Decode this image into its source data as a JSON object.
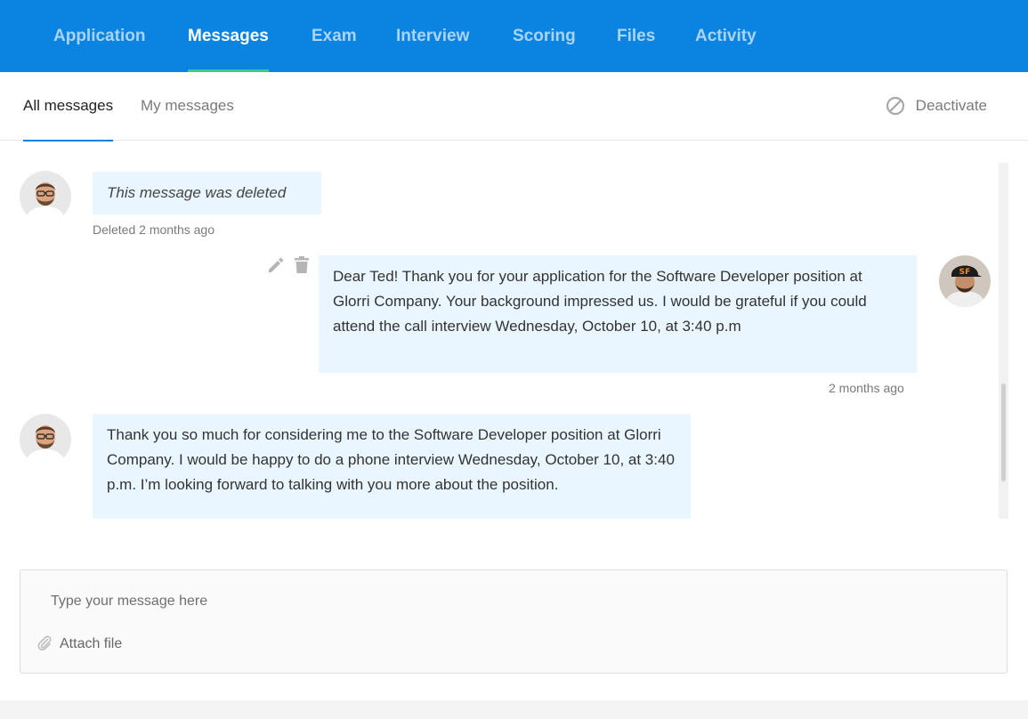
{
  "top_nav": {
    "tabs": [
      {
        "label": "Application",
        "active": false
      },
      {
        "label": "Messages",
        "active": true
      },
      {
        "label": "Exam",
        "active": false
      },
      {
        "label": "Interview",
        "active": false
      },
      {
        "label": "Scoring",
        "active": false
      },
      {
        "label": "Files",
        "active": false
      },
      {
        "label": "Activity",
        "active": false
      }
    ]
  },
  "sub_tabs": {
    "all_messages": "All messages",
    "my_messages": "My messages",
    "active": "All messages"
  },
  "deactivate": {
    "label": "Deactivate",
    "icon": "ban-icon"
  },
  "messages": [
    {
      "sender": "candidate",
      "deleted": true,
      "text": "This message was deleted",
      "meta": "Deleted 2 months ago"
    },
    {
      "sender": "recruiter",
      "deleted": false,
      "text": "Dear Ted! Thank you for your application for the Software Developer position at Glorri Company. Your background impressed us. I would be grateful if you could attend the call interview Wednesday, October 10, at 3:40 p.m",
      "meta": "2 months ago",
      "actions": [
        "edit-icon",
        "trash-icon"
      ]
    },
    {
      "sender": "candidate",
      "deleted": false,
      "text": "Thank you so much for considering me to the Software Developer position at Glorri Company. I would be happy to do a phone interview Wednesday, October 10, at 3:40 p.m. I’m looking forward to talking with you more about the position."
    }
  ],
  "composer": {
    "placeholder": "Type your message here",
    "attach_label": "Attach file",
    "attach_icon": "paperclip-icon"
  },
  "colors": {
    "header_blue": "#0a84e0",
    "active_tab_underline": "#3cc98a",
    "bubble_bg": "#eaf6ff"
  }
}
